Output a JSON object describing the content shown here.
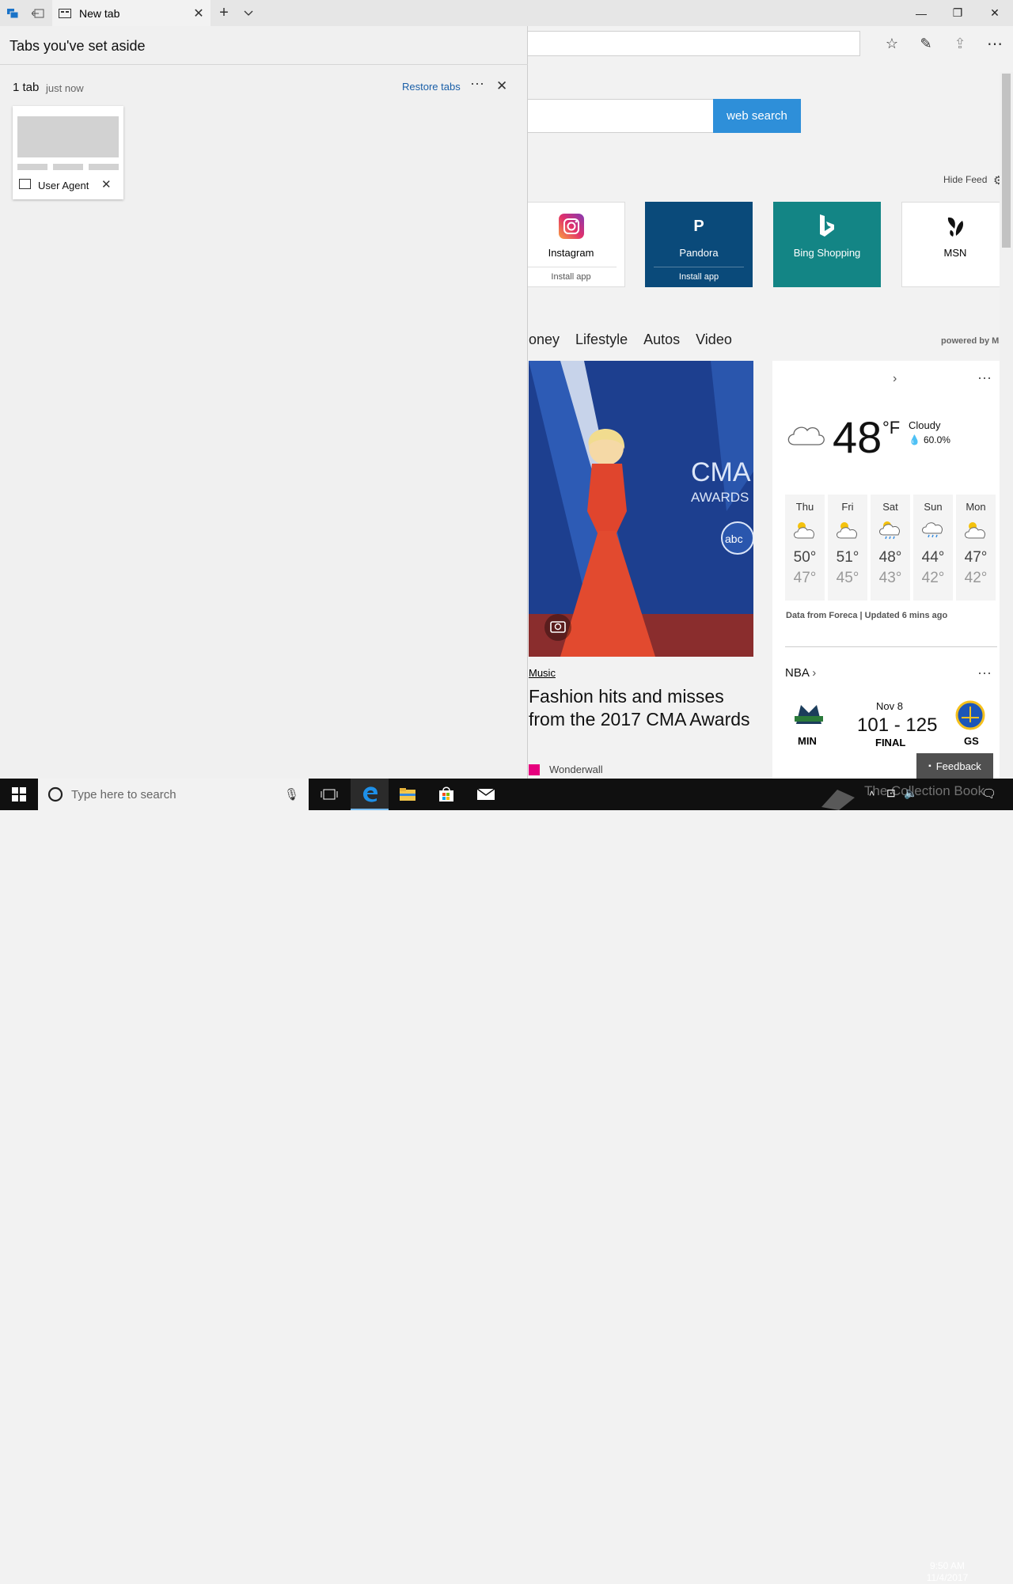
{
  "browser": {
    "tab_title": "New tab",
    "window_controls": {
      "minimize": "—",
      "maximize": "❐",
      "close": "✕"
    }
  },
  "panel": {
    "title": "Tabs you've set aside",
    "group_count": "1 tab",
    "group_time": "just now",
    "restore_label": "Restore tabs",
    "more_label": "···",
    "close_label": "✕",
    "saved_tab": {
      "title": "User Agent",
      "close": "✕"
    }
  },
  "newtab": {
    "search_button": "web search",
    "hide_feed": "Hide Feed",
    "tiles": [
      {
        "name": "Instagram",
        "sub": "Install app",
        "icon": "instagram-icon",
        "bg": "#ffffff",
        "fg": "#222222"
      },
      {
        "name": "Pandora",
        "sub": "Install app",
        "icon": "pandora-icon",
        "glyph": "P",
        "bg": "#0a4a7a",
        "fg": "#ffffff"
      },
      {
        "name": "Bing Shopping",
        "icon": "bing-icon",
        "glyph": "b",
        "bg": "#138585",
        "fg": "#ffffff"
      },
      {
        "name": "MSN",
        "icon": "msn-butterfly-icon",
        "bg": "#ffffff",
        "fg": "#222222"
      }
    ],
    "categories": [
      "oney",
      "Lifestyle",
      "Autos",
      "Video"
    ],
    "powered_by": "powered by MSN",
    "hero": {
      "category": "Music",
      "title": "Fashion hits and misses from the 2017 CMA Awards",
      "source": "Wonderwall"
    },
    "weather": {
      "temp": "48",
      "unit": "°F",
      "condition": "Cloudy",
      "precip": "60.0%",
      "days": [
        {
          "name": "Thu",
          "hi": "50°",
          "lo": "47°",
          "icon": "partly-sunny-icon"
        },
        {
          "name": "Fri",
          "hi": "51°",
          "lo": "45°",
          "icon": "partly-sunny-icon"
        },
        {
          "name": "Sat",
          "hi": "48°",
          "lo": "43°",
          "icon": "sun-rain-icon"
        },
        {
          "name": "Sun",
          "hi": "44°",
          "lo": "42°",
          "icon": "rain-cloud-icon"
        },
        {
          "name": "Mon",
          "hi": "47°",
          "lo": "42°",
          "icon": "partly-sunny-icon"
        }
      ],
      "source_note": "Data from Foreca | Updated 6 mins ago"
    },
    "nba": {
      "label": "NBA",
      "date": "Nov 8",
      "score": "101 - 125",
      "status": "FINAL",
      "home": "MIN",
      "away": "GS"
    },
    "feedback": "Feedback"
  },
  "taskbar": {
    "search_placeholder": "Type here to search",
    "time": "9:50 AM",
    "date": "11/4/2017",
    "watermark": "The Collection Book"
  },
  "colors": {
    "accent": "#2e8fd9",
    "link": "#1a5fa8",
    "taskbar": "#101010"
  }
}
